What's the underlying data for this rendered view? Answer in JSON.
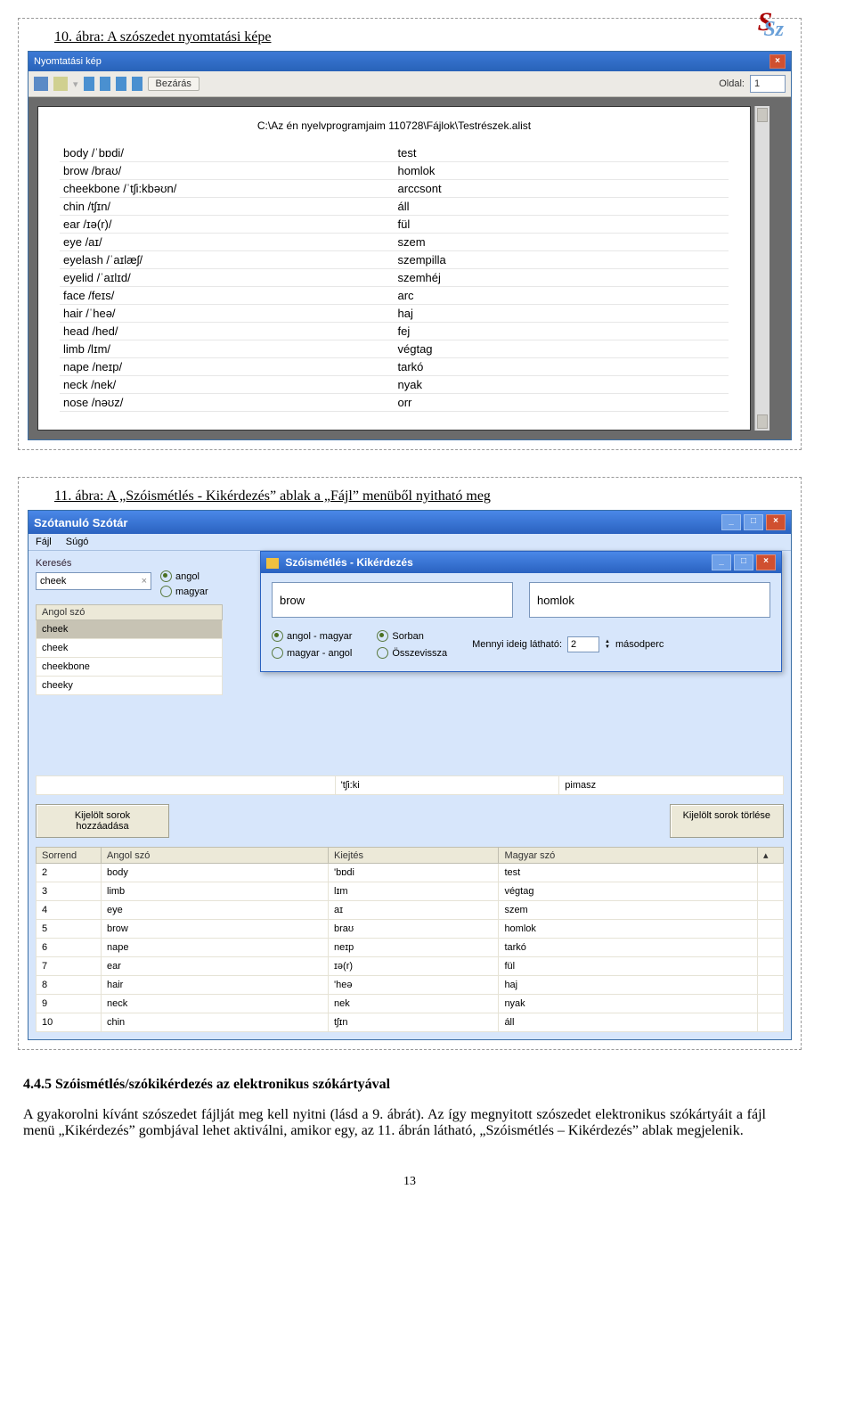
{
  "logo": {
    "top": "S",
    "sub": "Sz"
  },
  "fig10": {
    "caption": "10. ábra: A szószedet nyomtatási képe",
    "window_title": "Nyomtatási kép",
    "toolbar": {
      "close_btn": "Bezárás",
      "page_label": "Oldal:",
      "page_value": "1"
    },
    "path": "C:\\Az én nyelvprogramjaim 110728\\Fájlok\\Testrészek.alist",
    "rows": [
      {
        "l": "body /ˈbɒdi/",
        "r": "test"
      },
      {
        "l": "brow /braʊ/",
        "r": "homlok"
      },
      {
        "l": "cheekbone /ˈtʃi:kbəʊn/",
        "r": "arccsont"
      },
      {
        "l": "chin /tʃɪn/",
        "r": "áll"
      },
      {
        "l": "ear /ɪə(r)/",
        "r": "fül"
      },
      {
        "l": "eye /aɪ/",
        "r": "szem"
      },
      {
        "l": "eyelash /ˈaɪlæʃ/",
        "r": "szempilla"
      },
      {
        "l": "eyelid /ˈaɪlɪd/",
        "r": "szemhéj"
      },
      {
        "l": "face /feɪs/",
        "r": "arc"
      },
      {
        "l": "hair /ˈheə/",
        "r": "haj"
      },
      {
        "l": "head /hed/",
        "r": "fej"
      },
      {
        "l": "limb /lɪm/",
        "r": "végtag"
      },
      {
        "l": "nape /neɪp/",
        "r": "tarkó"
      },
      {
        "l": "neck /nek/",
        "r": "nyak"
      },
      {
        "l": "nose /nəʊz/",
        "r": "orr"
      }
    ]
  },
  "fig11": {
    "caption": "11. ábra: A „Szóismétlés - Kikérdezés” ablak a „Fájl” menüből nyitható meg",
    "app_title": "Szótanuló Szótár",
    "menu": {
      "file": "Fájl",
      "help": "Súgó"
    },
    "search": {
      "label": "Keresés",
      "value": "cheek",
      "lang_en": "angol",
      "lang_hu": "magyar"
    },
    "toplist": {
      "header": "Angol szó",
      "rows": [
        "cheek",
        "cheek",
        "cheekbone",
        "cheeky"
      ]
    },
    "dialog": {
      "title": "Szóismétlés - Kikérdezés",
      "word_l": "brow",
      "word_r": "homlok",
      "dir_en_hu": "angol - magyar",
      "dir_hu_en": "magyar - angol",
      "order_seq": "Sorban",
      "order_rand": "Összevissza",
      "duration_label": "Mennyi ideig látható:",
      "duration_value": "2",
      "duration_unit": "másodperc"
    },
    "extra_row": {
      "ipa": "'tʃi:ki",
      "hu": "pimasz"
    },
    "buttons": {
      "add": "Kijelölt sorok hozzáadása",
      "remove": "Kijelölt sorok törlése"
    },
    "bottom_table": {
      "headers": {
        "c0": "Sorrend",
        "c1": "Angol szó",
        "c2": "Kiejtés",
        "c3": "Magyar szó"
      },
      "rows": [
        {
          "n": "2",
          "en": "body",
          "ipa": "'bɒdi",
          "hu": "test"
        },
        {
          "n": "3",
          "en": "limb",
          "ipa": "lɪm",
          "hu": "végtag"
        },
        {
          "n": "4",
          "en": "eye",
          "ipa": "aɪ",
          "hu": "szem"
        },
        {
          "n": "5",
          "en": "brow",
          "ipa": "braʊ",
          "hu": "homlok"
        },
        {
          "n": "6",
          "en": "nape",
          "ipa": "neɪp",
          "hu": "tarkó"
        },
        {
          "n": "7",
          "en": "ear",
          "ipa": "ɪə(r)",
          "hu": "fül"
        },
        {
          "n": "8",
          "en": "hair",
          "ipa": "'heə",
          "hu": "haj"
        },
        {
          "n": "9",
          "en": "neck",
          "ipa": "nek",
          "hu": "nyak"
        },
        {
          "n": "10",
          "en": "chin",
          "ipa": "tʃɪn",
          "hu": "áll"
        }
      ]
    }
  },
  "section": {
    "heading": "4.4.5   Szóismétlés/szókikérdezés az elektronikus szókártyával",
    "para": "A gyakorolni kívánt szószedet fájlját meg kell nyitni (lásd a 9. ábrát). Az így megnyitott szószedet elektronikus szókártyáit a fájl menü „Kikérdezés” gombjával lehet aktiválni, amikor egy, az 11. ábrán látható, „Szóismétlés – Kikérdezés” ablak megjelenik."
  },
  "page_number": "13"
}
